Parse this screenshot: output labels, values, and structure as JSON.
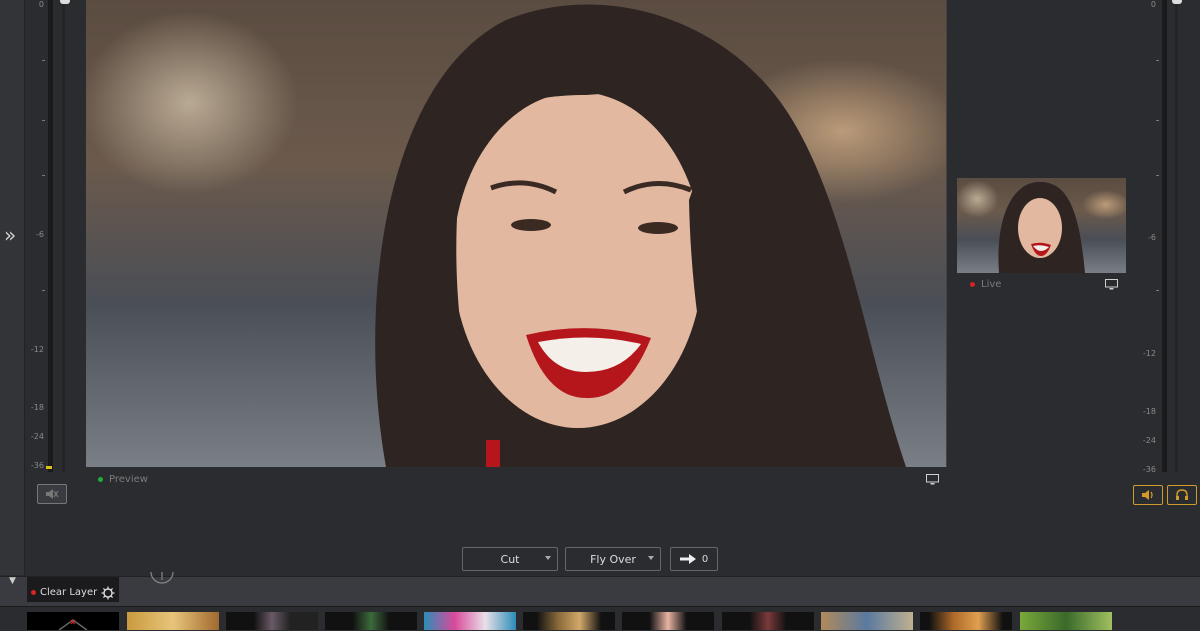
{
  "meters": {
    "left_ticks": [
      "0",
      "-6",
      "-12",
      "-18",
      "-24",
      "-36"
    ],
    "right_ticks": [
      "0",
      "-6",
      "-12",
      "-18",
      "-24",
      "-36"
    ]
  },
  "preview": {
    "label": "Preview",
    "status_color": "#1fae3a"
  },
  "live": {
    "label": "Live",
    "status_color": "#d62424"
  },
  "transition": {
    "type_value": "Cut",
    "effect_value": "Fly Over",
    "go_value": "0"
  },
  "layer": {
    "clear_label": "Clear Layer",
    "status_color": "#d62424"
  },
  "accent_color": "#d19b2c",
  "thumbnails": [
    {
      "name": "clear"
    },
    {
      "name": "media-1"
    },
    {
      "name": "media-2"
    },
    {
      "name": "media-3"
    },
    {
      "name": "media-4"
    },
    {
      "name": "media-5"
    },
    {
      "name": "media-6"
    },
    {
      "name": "media-7"
    },
    {
      "name": "media-8"
    },
    {
      "name": "media-9"
    },
    {
      "name": "media-10"
    }
  ]
}
